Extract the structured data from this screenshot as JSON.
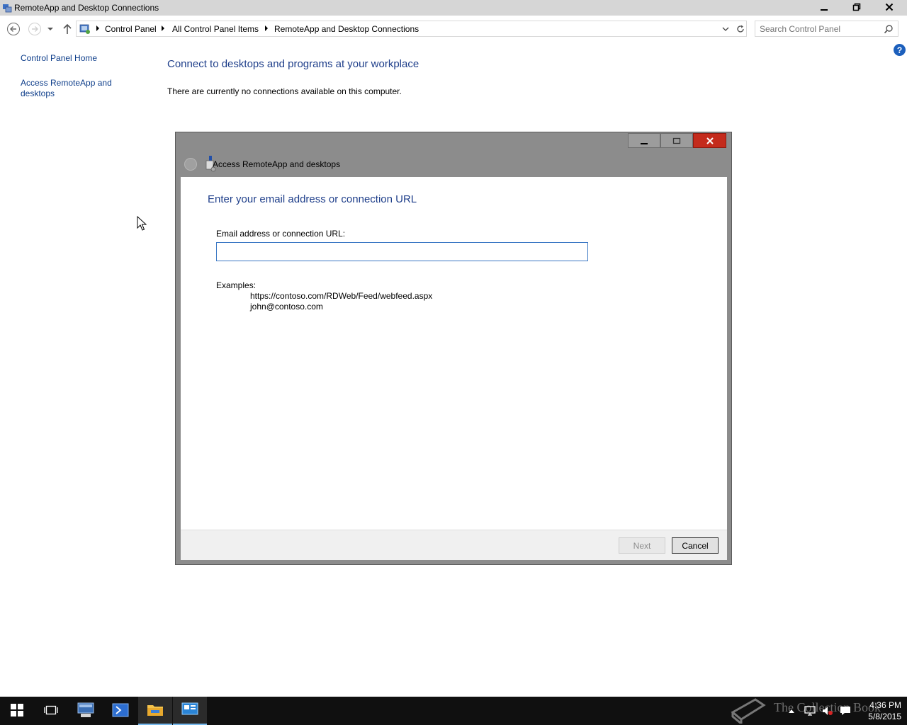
{
  "window": {
    "title": "RemoteApp and Desktop Connections",
    "icon": "remoteapp-icon"
  },
  "address_bar": {
    "crumbs": [
      "Control Panel",
      "All Control Panel Items",
      "RemoteApp and Desktop Connections"
    ],
    "search_placeholder": "Search Control Panel"
  },
  "left_pane": {
    "home_link": "Control Panel Home",
    "access_link": "Access RemoteApp and desktops"
  },
  "main": {
    "heading": "Connect to desktops and programs at your workplace",
    "description": "There are currently no connections available on this computer.",
    "help_label": "?"
  },
  "dialog": {
    "title": "Access RemoteApp and desktops",
    "heading": "Enter your email address or connection URL",
    "field_label": "Email address or connection URL:",
    "field_value": "",
    "examples_label": "Examples:",
    "examples": [
      "https://contoso.com/RDWeb/Feed/webfeed.aspx",
      "john@contoso.com"
    ],
    "next_label": "Next",
    "cancel_label": "Cancel"
  },
  "taskbar": {
    "items": [
      "start-icon",
      "task-view-icon",
      "server-manager-icon",
      "powershell-icon",
      "file-explorer-icon",
      "control-panel-icon"
    ],
    "watermark": "The Collection Book",
    "time": "4:36 PM",
    "date": "5/8/2015"
  },
  "colors": {
    "link": "#0d3d8a",
    "heading": "#1e3e8a",
    "close_red": "#c42b1c",
    "taskbar": "#101010"
  }
}
